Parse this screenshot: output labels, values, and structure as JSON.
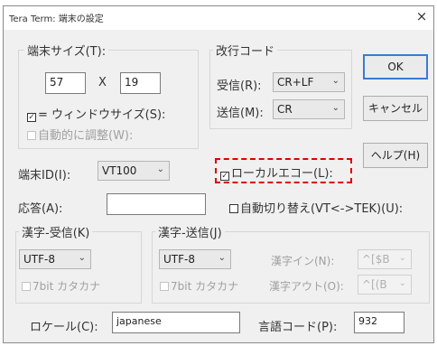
{
  "window": {
    "title": "Tera Term: 端末の設定",
    "close_glyph": "×"
  },
  "terminal_size": {
    "group_label": "端末サイズ(T):",
    "cols": "57",
    "separator": "X",
    "rows": "19",
    "equals_window_size_label": "= ウィンドウサイズ(S):",
    "auto_adjust_label": "自動的に調整(W):"
  },
  "newline": {
    "group_label": "改行コード",
    "receive_label": "受信(R):",
    "receive_value": "CR+LF",
    "transmit_label": "送信(M):",
    "transmit_value": "CR"
  },
  "buttons": {
    "ok": "OK",
    "cancel": "キャンセル",
    "help": "ヘルプ(H)"
  },
  "terminal_id": {
    "label": "端末ID(I):",
    "value": "VT100"
  },
  "local_echo": {
    "label": "ローカルエコー(L):",
    "checked": true
  },
  "answerback": {
    "label": "応答(A):",
    "value": ""
  },
  "auto_switch": {
    "label": "自動切り替え(VT<->TEK)(U):",
    "checked": false
  },
  "kanji_receive": {
    "group_label": "漢字-受信(K)",
    "value": "UTF-8",
    "katakana_label": "7bit カタカナ"
  },
  "kanji_transmit": {
    "group_label": "漢字-送信(J)",
    "value": "UTF-8",
    "katakana_label": "7bit カタカナ",
    "kanji_in_label": "漢字イン(N):",
    "kanji_in_value": "^[$B",
    "kanji_out_label": "漢字アウト(O):",
    "kanji_out_value": "^[(B"
  },
  "locale": {
    "label": "ロケール(C):",
    "value": "japanese"
  },
  "code_page": {
    "label": "言語コード(P):",
    "value": "932"
  },
  "icons": {
    "check": "✓",
    "dropdown": "⌄"
  },
  "colors": {
    "highlight": "#e00000",
    "default_button_border": "#3a7bd5"
  }
}
